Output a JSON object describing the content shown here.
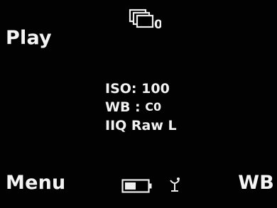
{
  "softkeys": {
    "top_left": "Play",
    "bottom_left": "Menu",
    "bottom_right": "WB"
  },
  "card_indicator": {
    "count": "0",
    "icon": "memory-cards-icon"
  },
  "info": {
    "iso_label": "ISO:",
    "iso_value": "100",
    "wb_label": "WB :",
    "wb_value_icon": "auto-white-balance-icon",
    "wb_value_text": "C0",
    "format": "IIQ Raw L"
  },
  "status": {
    "battery_icon": "battery-icon",
    "battery_level": 0.5,
    "gps_icon": "gps-satellite-icon"
  },
  "colors": {
    "background": "#020202",
    "text": "#f2f2f2"
  }
}
